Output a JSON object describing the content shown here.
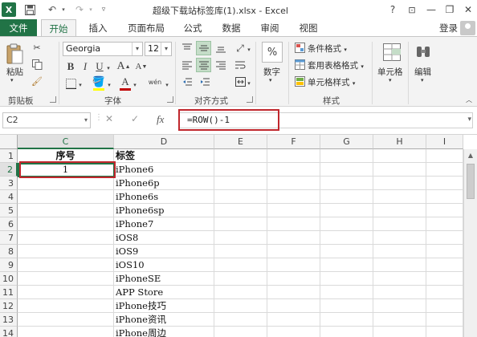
{
  "window": {
    "title": "超级下载站标签库(1).xlsx - Excel",
    "help": "?",
    "ribbon_opts": "⊡",
    "minimize": "—",
    "restore": "❐",
    "close": "✕"
  },
  "tabs": [
    "文件",
    "开始",
    "插入",
    "页面布局",
    "公式",
    "数据",
    "审阅",
    "视图"
  ],
  "active_tab": "开始",
  "login_label": "登录",
  "ribbon": {
    "clipboard": {
      "paste": "粘贴",
      "group": "剪贴板"
    },
    "font": {
      "name": "Georgia",
      "size": "12",
      "group": "字体",
      "bold": "B",
      "italic": "I",
      "underline": "U",
      "grow": "A",
      "shrink": "A"
    },
    "alignment": {
      "group": "对齐方式"
    },
    "number": {
      "percent": "%",
      "label": "数字"
    },
    "styles": {
      "conditional": "条件格式",
      "table": "套用表格格式",
      "cell": "单元格样式",
      "group": "样式"
    },
    "cells": {
      "label": "单元格"
    },
    "editing": {
      "label": "编辑"
    }
  },
  "formula_bar": {
    "name_box": "C2",
    "cancel": "✕",
    "enter": "✓",
    "fx": "fx",
    "formula": "=ROW()-1"
  },
  "sheet": {
    "columns": [
      "C",
      "D",
      "E",
      "F",
      "G",
      "H",
      "I"
    ],
    "selected_column": "C",
    "selected_row": "2",
    "rows": [
      {
        "num": "1",
        "c": "序号",
        "d": "标签"
      },
      {
        "num": "2",
        "c": "1",
        "d": "iPhone6"
      },
      {
        "num": "3",
        "c": "",
        "d": "iPhone6p"
      },
      {
        "num": "4",
        "c": "",
        "d": "iPhone6s"
      },
      {
        "num": "5",
        "c": "",
        "d": "iPhone6sp"
      },
      {
        "num": "6",
        "c": "",
        "d": "iPhone7"
      },
      {
        "num": "7",
        "c": "",
        "d": "iOS8"
      },
      {
        "num": "8",
        "c": "",
        "d": "iOS9"
      },
      {
        "num": "9",
        "c": "",
        "d": "iOS10"
      },
      {
        "num": "10",
        "c": "",
        "d": "iPhoneSE"
      },
      {
        "num": "11",
        "c": "",
        "d": "APP Store"
      },
      {
        "num": "12",
        "c": "",
        "d": "iPhone技巧"
      },
      {
        "num": "13",
        "c": "",
        "d": "iPhone资讯"
      },
      {
        "num": "14",
        "c": "",
        "d": "iPhone周边"
      }
    ]
  },
  "colors": {
    "excel_green": "#217346",
    "highlight_red": "#c0272d",
    "font_red": "#c00000",
    "fill_yellow": "#ffff00"
  }
}
